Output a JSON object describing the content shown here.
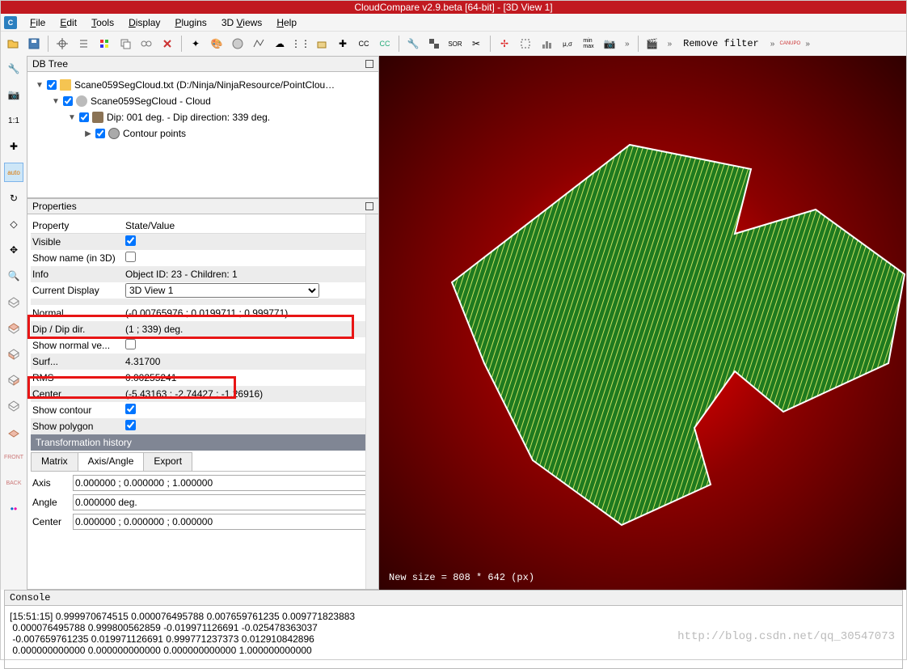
{
  "title": "CloudCompare v2.9.beta [64-bit] - [3D View 1]",
  "menu": [
    "File",
    "Edit",
    "Tools",
    "Display",
    "Plugins",
    "3D Views",
    "Help"
  ],
  "panels": {
    "dbtree": "DB Tree",
    "properties": "Properties",
    "console": "Console"
  },
  "tree": {
    "root": "Scane059SegCloud.txt (D:/Ninja/NinjaResource/PointClou…",
    "child1": "Scane059SegCloud - Cloud",
    "child2": "Dip: 001 deg. - Dip direction: 339 deg.",
    "child3": "Contour points"
  },
  "props": {
    "h1": "Property",
    "h2": "State/Value",
    "visible": "Visible",
    "showname": "Show name (in 3D)",
    "info": "Info",
    "info_v": "Object ID: 23 - Children: 1",
    "currdisp": "Current Display",
    "currdisp_v": "3D View 1",
    "normal": "Normal",
    "normal_v": "(-0.00765976 ; 0.0199711 ; 0.999771)",
    "dipdir": "Dip / Dip dir.",
    "dipdir_v": "(1 ; 339) deg.",
    "shownv": "Show normal ve...",
    "surf": "Surf...",
    "surf_v": "4.31700",
    "rms": "RMS",
    "rms_v": "0.00255241",
    "center": "Center",
    "center_v": "(-5.43163 ; -2.74427 ; -1.26916)",
    "showcontour": "Show contour",
    "showpoly": "Show polygon",
    "section": "Transformation history",
    "tabs": [
      "Matrix",
      "Axis/Angle",
      "Export"
    ],
    "axis": "Axis",
    "axis_v": "0.000000 ; 0.000000 ; 1.000000",
    "angle": "Angle",
    "angle_v": "0.000000 deg.",
    "tcenter": "Center",
    "tcenter_v": "0.000000 ; 0.000000 ; 0.000000"
  },
  "viewport_text": "New size = 808 * 642 (px)",
  "remove_filter": "Remove filter",
  "console_lines": "[15:51:15] 0.999970674515 0.000076495788 0.007659761235 0.009771823883\n 0.000076495788 0.999800562859 -0.019971126691 -0.025478363037\n -0.007659761235 0.019971126691 0.999771237373 0.012910842896\n 0.000000000000 0.000000000000 0.000000000000 1.000000000000",
  "watermark": "http://blog.csdn.net/qq_30547073"
}
